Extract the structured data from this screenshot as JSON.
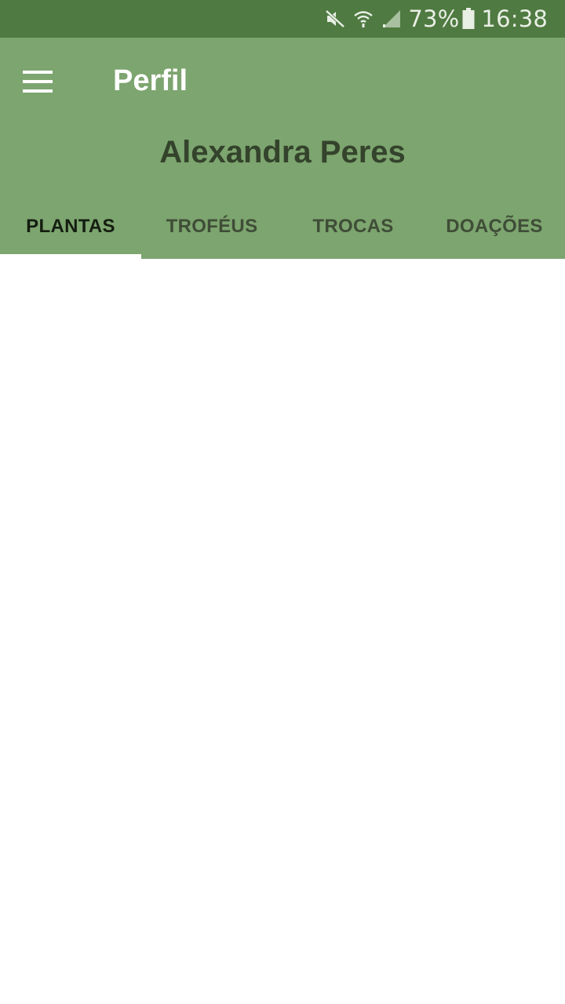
{
  "status_bar": {
    "icons": [
      "mute-icon",
      "wifi-icon",
      "signal-icon",
      "battery-icon"
    ],
    "battery": "73%",
    "time": "16:38"
  },
  "app_bar": {
    "title": "Perfil",
    "menu_icon": "hamburger-menu-icon"
  },
  "profile": {
    "name": "Alexandra Peres"
  },
  "tabs": [
    {
      "label": "PLANTAS",
      "active": true
    },
    {
      "label": "TROFÉUS",
      "active": false
    },
    {
      "label": "TROCAS",
      "active": false
    },
    {
      "label": "DOAÇÕES",
      "active": false
    }
  ],
  "colors": {
    "status_bar": "#4f7a41",
    "app_bar": "#7da56f",
    "name_text": "#34432c",
    "tab_indicator": "#ffffff"
  }
}
